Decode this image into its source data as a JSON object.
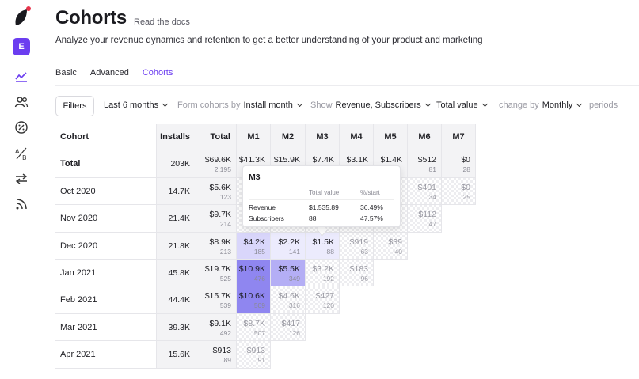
{
  "header": {
    "title": "Cohorts",
    "docs_link": "Read the docs",
    "subtitle": "Analyze your revenue dynamics and retention to get a better understanding of your product and marketing"
  },
  "sidebar": {
    "avatar_letter": "E",
    "icons": [
      "logo-icon",
      "chart-line-icon",
      "users-icon",
      "discount-badge-icon",
      "ab-test-icon",
      "transfer-arrows-icon",
      "rss-feed-icon"
    ]
  },
  "tabs": [
    {
      "label": "Basic"
    },
    {
      "label": "Advanced"
    },
    {
      "label": "Cohorts",
      "active": true
    }
  ],
  "filters": {
    "filters_button": "Filters",
    "period": "Last 6 months",
    "form_label": "Form cohorts by",
    "form_value": "Install month",
    "show_label": "Show",
    "show_value": "Revenue, Subscribers",
    "total_value": "Total value",
    "change_label": "change by",
    "change_value": "Monthly",
    "periods_label": "periods"
  },
  "table": {
    "headers": [
      "Cohort",
      "Installs",
      "Total",
      "M1",
      "M2",
      "M3",
      "M4",
      "M5",
      "M6",
      "M7"
    ],
    "rows": [
      {
        "cohort": "Total",
        "installs": "203K",
        "total": {
          "v": "$69.6K",
          "s": "2,195"
        },
        "cells": [
          {
            "v": "$41.3K",
            "s": ""
          },
          {
            "v": "$15.9K",
            "s": ""
          },
          {
            "v": "$7.4K",
            "s": ""
          },
          {
            "v": "$3.1K",
            "s": ""
          },
          {
            "v": "$1.4K",
            "s": ""
          },
          {
            "v": "$512",
            "s": "81"
          },
          {
            "v": "$0",
            "s": "28"
          }
        ]
      },
      {
        "cohort": "Oct 2020",
        "installs": "14.7K",
        "total": {
          "v": "$5.6K",
          "s": "123"
        },
        "cells": [
          {
            "v": "",
            "s": ""
          },
          {
            "v": "",
            "s": ""
          },
          {
            "v": "",
            "s": ""
          },
          {
            "v": "",
            "s": ""
          },
          {
            "v": "",
            "s": ""
          },
          {
            "v": "$401",
            "s": "34"
          },
          {
            "v": "$0",
            "s": "25"
          }
        ]
      },
      {
        "cohort": "Nov 2020",
        "installs": "21.4K",
        "total": {
          "v": "$9.7K",
          "s": "214"
        },
        "cells": [
          {
            "v": "",
            "s": ""
          },
          {
            "v": "",
            "s": ""
          },
          {
            "v": "",
            "s": ""
          },
          {
            "v": "",
            "s": ""
          },
          {
            "v": "",
            "s": ""
          },
          {
            "v": "$112",
            "s": "47"
          }
        ]
      },
      {
        "cohort": "Dec 2020",
        "installs": "21.8K",
        "total": {
          "v": "$8.9K",
          "s": "213"
        },
        "cells": [
          {
            "v": "$4.2K",
            "s": "185"
          },
          {
            "v": "$2.2K",
            "s": "141"
          },
          {
            "v": "$1.5K",
            "s": "88"
          },
          {
            "v": "$919",
            "s": "63"
          },
          {
            "v": "$39",
            "s": "40"
          }
        ]
      },
      {
        "cohort": "Jan 2021",
        "installs": "45.8K",
        "total": {
          "v": "$19.7K",
          "s": "525"
        },
        "cells": [
          {
            "v": "$10.9K",
            "s": "476"
          },
          {
            "v": "$5.5K",
            "s": "349"
          },
          {
            "v": "$3.2K",
            "s": "192"
          },
          {
            "v": "$183",
            "s": "96"
          }
        ]
      },
      {
        "cohort": "Feb 2021",
        "installs": "44.4K",
        "total": {
          "v": "$15.7K",
          "s": "539"
        },
        "cells": [
          {
            "v": "$10.6K",
            "s": "509"
          },
          {
            "v": "$4.6K",
            "s": "316"
          },
          {
            "v": "$427",
            "s": "120"
          }
        ]
      },
      {
        "cohort": "Mar 2021",
        "installs": "39.3K",
        "total": {
          "v": "$9.1K",
          "s": "492"
        },
        "cells": [
          {
            "v": "$8.7K",
            "s": "507"
          },
          {
            "v": "$417",
            "s": "126"
          }
        ]
      },
      {
        "cohort": "Apr 2021",
        "installs": "15.6K",
        "total": {
          "v": "$913",
          "s": "89"
        },
        "cells": [
          {
            "v": "$913",
            "s": "91"
          }
        ]
      }
    ]
  },
  "tooltip": {
    "title": "M3",
    "col_total": "Total value",
    "col_start": "%/start",
    "rows": [
      {
        "label": "Revenue",
        "total": "$1,535.89",
        "start": "36.49%"
      },
      {
        "label": "Subscribers",
        "total": "88",
        "start": "47.57%"
      }
    ]
  },
  "colors": {
    "accent": "#6b3df0",
    "heat_strong": "#8f86f0",
    "heat_mid": "#b4aef5",
    "heat_light": "#d9d6fb",
    "heat_faint": "#ecebfd"
  }
}
